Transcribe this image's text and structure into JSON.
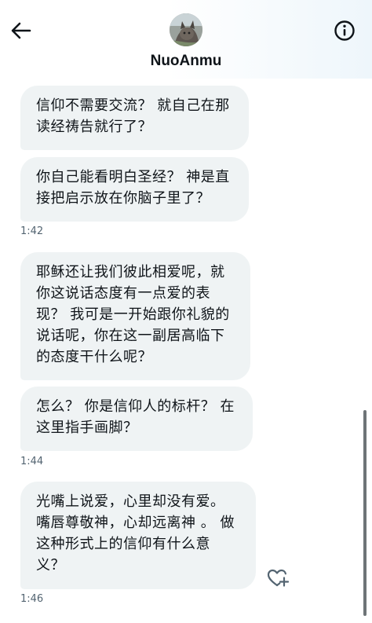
{
  "header": {
    "username": "NuoAnmu",
    "back_icon": "arrow-left-icon",
    "info_icon": "info-circle-icon"
  },
  "messages": [
    {
      "lines": [
        "信仰不需要交流？ 就自己在那",
        "读经祷告就行了？"
      ]
    },
    {
      "lines": [
        "你自己能看明白圣经？ 神是直",
        "接把启示放在你脑子里了？"
      ],
      "timestamp": "1:42"
    },
    {
      "lines": [
        "耶稣还让我们彼此相爱呢，就",
        "你这说话态度有一点爱的表",
        "现？ 我可是一开始跟你礼貌的",
        "说话呢，你在这一副居高临下",
        "的态度干什么呢？"
      ]
    },
    {
      "lines": [
        "怎么？ 你是信仰人的标杆？ 在",
        "这里指手画脚？"
      ],
      "timestamp": "1:44"
    },
    {
      "lines": [
        "光嘴上说爱，心里却没有爱。",
        "嘴唇尊敬神，心却远离神 。 做",
        "这种形式上的信仰有什么意",
        "义？"
      ],
      "timestamp": "1:46"
    }
  ],
  "react_icon": "heart-plus-icon",
  "colors": {
    "bubble_bg": "#eff3f4",
    "text": "#0f1419",
    "muted": "#536471"
  }
}
